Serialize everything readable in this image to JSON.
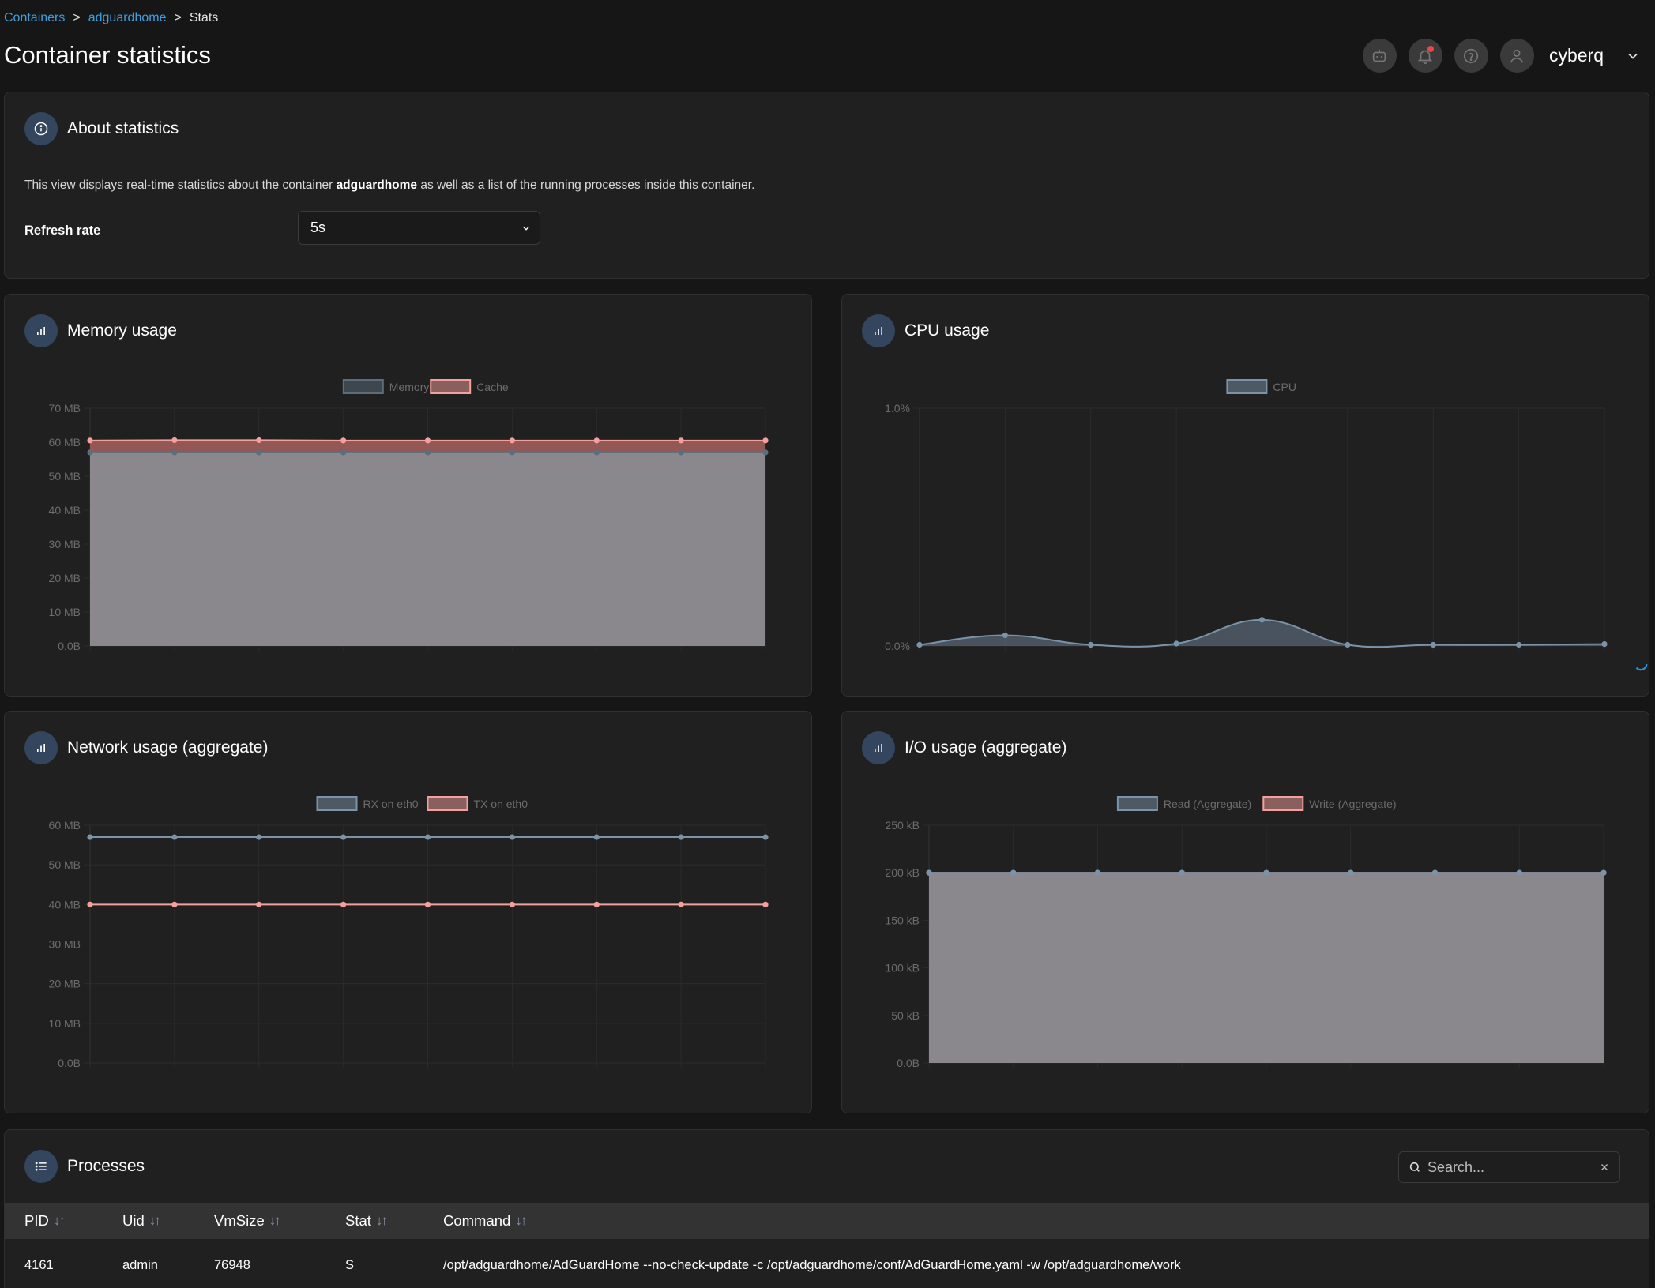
{
  "breadcrumb": {
    "items": [
      "Containers",
      "adguardhome"
    ],
    "current": "Stats",
    "separator": ">"
  },
  "page": {
    "title": "Container statistics"
  },
  "header": {
    "user_name": "cyberq"
  },
  "about": {
    "title": "About statistics",
    "desc_prefix": "This view displays real-time statistics about the container ",
    "container": "adguardhome",
    "desc_suffix": " as well as a list of the running processes inside this container.",
    "refresh_label": "Refresh rate",
    "refresh_value": "5s"
  },
  "charts": {
    "memory": {
      "title": "Memory usage"
    },
    "cpu": {
      "title": "CPU usage"
    },
    "network": {
      "title": "Network usage (aggregate)"
    },
    "io": {
      "title": "I/O usage (aggregate)"
    }
  },
  "chart_data": [
    {
      "id": "memory",
      "type": "area",
      "title": "Memory usage",
      "y_ticks": [
        "0.0B",
        "10 MB",
        "20 MB",
        "30 MB",
        "40 MB",
        "50 MB",
        "60 MB",
        "70 MB"
      ],
      "ylim": [
        0,
        70
      ],
      "y_unit": "MB",
      "legend_position": "top-center",
      "series": [
        {
          "name": "Memory",
          "values": [
            57,
            57,
            57,
            57,
            57,
            57,
            57,
            57,
            57
          ],
          "color": "#5c6e7c",
          "fill": true
        },
        {
          "name": "Cache",
          "values": [
            60.5,
            60.6,
            60.6,
            60.5,
            60.5,
            60.5,
            60.5,
            60.5,
            60.5
          ],
          "color": "#f4a09c",
          "fill": true
        }
      ]
    },
    {
      "id": "cpu",
      "type": "area",
      "title": "CPU usage",
      "y_ticks": [
        "0.0%",
        "1.0%"
      ],
      "ylim": [
        0,
        1
      ],
      "y_unit": "%",
      "legend_position": "top-center",
      "series": [
        {
          "name": "CPU",
          "values": [
            0.005,
            0.045,
            0.005,
            0.01,
            0.11,
            0.005,
            0.005,
            0.005,
            0.008
          ],
          "color": "#7a93a8",
          "fill": true
        }
      ]
    },
    {
      "id": "network",
      "type": "line",
      "title": "Network usage (aggregate)",
      "y_ticks": [
        "0.0B",
        "10 MB",
        "20 MB",
        "30 MB",
        "40 MB",
        "50 MB",
        "60 MB"
      ],
      "ylim": [
        0,
        60
      ],
      "y_unit": "MB",
      "legend_position": "top-center",
      "series": [
        {
          "name": "RX on eth0",
          "values": [
            57,
            57,
            57,
            57,
            57,
            57,
            57,
            57,
            57
          ],
          "color": "#7a93a8",
          "fill": false
        },
        {
          "name": "TX on eth0",
          "values": [
            40,
            40,
            40,
            40,
            40,
            40,
            40,
            40,
            40
          ],
          "color": "#f4a09c",
          "fill": false
        }
      ]
    },
    {
      "id": "io",
      "type": "area",
      "title": "I/O usage (aggregate)",
      "y_ticks": [
        "0.0B",
        "50 kB",
        "100 kB",
        "150 kB",
        "200 kB",
        "250 kB"
      ],
      "ylim": [
        0,
        250
      ],
      "y_unit": "kB",
      "legend_position": "top-center",
      "series": [
        {
          "name": "Read (Aggregate)",
          "values": [
            200,
            200,
            200,
            200,
            200,
            200,
            200,
            200,
            200
          ],
          "color": "#7a93a8",
          "fill": true
        },
        {
          "name": "Write (Aggregate)",
          "values": [
            200,
            200,
            200,
            200,
            200,
            200,
            200,
            200,
            200
          ],
          "color": "#f4a09c",
          "fill": false
        }
      ]
    }
  ],
  "processes": {
    "title": "Processes",
    "search_placeholder": "Search...",
    "columns": [
      "PID",
      "Uid",
      "VmSize",
      "Stat",
      "Command"
    ],
    "rows": [
      [
        "4161",
        "admin",
        "76948",
        "S",
        "/opt/adguardhome/AdGuardHome --no-check-update -c /opt/adguardhome/conf/AdGuardHome.yaml -w /opt/adguardhome/work"
      ]
    ]
  }
}
